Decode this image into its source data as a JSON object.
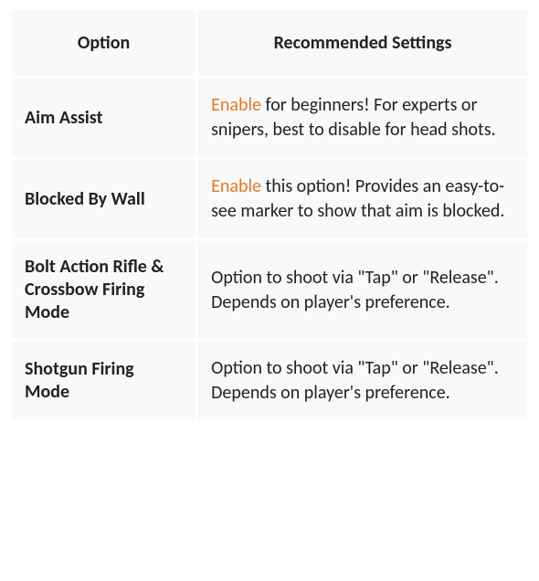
{
  "table": {
    "headers": {
      "option": "Option",
      "recommended": "Recommended Settings"
    },
    "highlight_color": "#e07a2b",
    "rows": [
      {
        "option": "Aim Assist",
        "highlight": "Enable",
        "rest": " for beginners! For experts or snipers, best to disable for head shots."
      },
      {
        "option": "Blocked By Wall",
        "highlight": "Enable",
        "rest": " this option! Provides an easy-to-see marker to show that aim is blocked."
      },
      {
        "option": "Bolt Action Rifle & Crossbow Firing Mode",
        "highlight": "",
        "rest": "Option to shoot via \"Tap\" or \"Release\". Depends on player's preference."
      },
      {
        "option": "Shotgun Firing Mode",
        "highlight": "",
        "rest": "Option to shoot via \"Tap\" or \"Release\". Depends on player's preference."
      }
    ]
  }
}
